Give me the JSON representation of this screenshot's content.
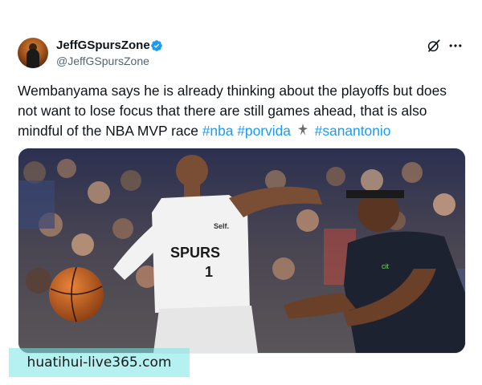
{
  "author": {
    "display_name": "JeffGSpursZone",
    "handle": "@JeffGSpursZone",
    "verified": true
  },
  "tweet": {
    "text_plain": "Wembanyama says he is already thinking about the playoffs but does not want to lose focus that there are still games ahead, that is also mindful of the NBA MVP race ",
    "hashtags": [
      "#nba",
      "#porvida",
      "#sanantonio"
    ],
    "emoji_icon": "spurs-emoji-icon"
  },
  "media": {
    "jersey_brand": "Self.",
    "jersey_team": "SPURS",
    "jersey_number": "1",
    "opponent_logo_text": "cit"
  },
  "icons": {
    "verified": "verified-badge-icon",
    "grok": "grok-icon",
    "more": "more-options-icon"
  },
  "colors": {
    "hashtag": "#1d9bf0",
    "verified": "#1d9bf0",
    "secondary_text": "#536471"
  },
  "watermark": {
    "text": "huatihui-live365.com"
  }
}
